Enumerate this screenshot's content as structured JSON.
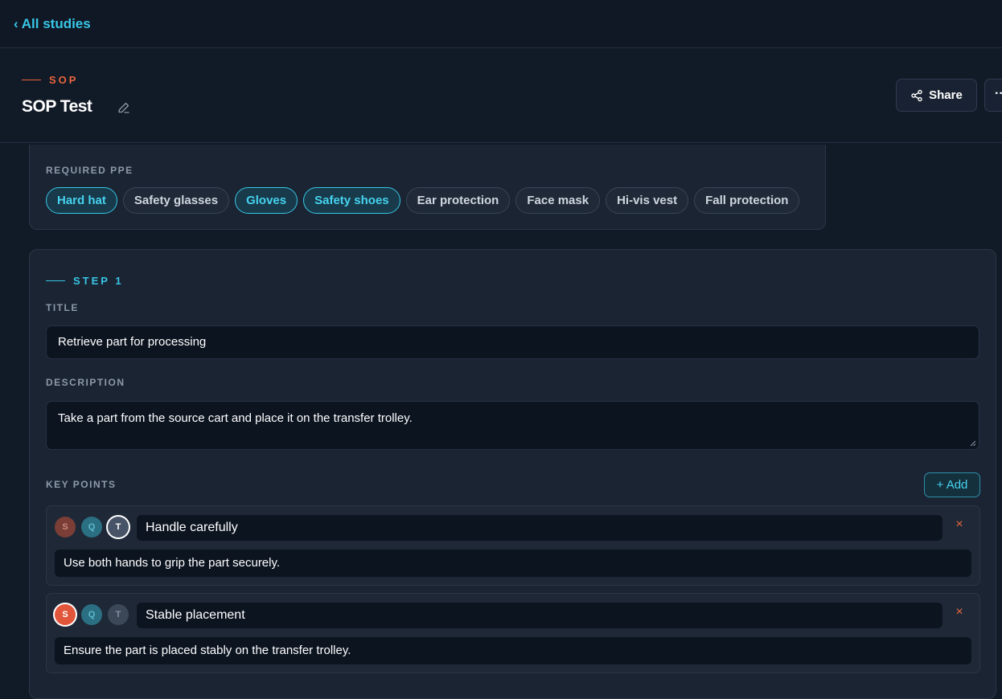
{
  "nav": {
    "back_label": "‹ All studies"
  },
  "header": {
    "eyebrow": "SOP",
    "title": "SOP Test",
    "share_label": "Share",
    "more_label": "···"
  },
  "ppe": {
    "label": "REQUIRED PPE",
    "chips": [
      {
        "label": "Hard hat",
        "selected": true
      },
      {
        "label": "Safety glasses",
        "selected": false
      },
      {
        "label": "Gloves",
        "selected": true
      },
      {
        "label": "Safety shoes",
        "selected": true
      },
      {
        "label": "Ear protection",
        "selected": false
      },
      {
        "label": "Face mask",
        "selected": false
      },
      {
        "label": "Hi-vis vest",
        "selected": false
      },
      {
        "label": "Fall protection",
        "selected": false
      }
    ]
  },
  "step": {
    "eyebrow": "STEP 1",
    "title_label": "TITLE",
    "title_value": "Retrieve part for processing",
    "description_label": "DESCRIPTION",
    "description_value": "Take a part from the source cart and place it on the transfer trolley.",
    "key_points_label": "KEY POINTS",
    "add_label": "+ Add",
    "key_points": [
      {
        "badges": {
          "s": "S",
          "q": "Q",
          "t": "T"
        },
        "active": "T",
        "title": "Handle carefully",
        "body": "Use both hands to grip the part securely.",
        "remove": "×"
      },
      {
        "badges": {
          "s": "S",
          "q": "Q",
          "t": "T"
        },
        "active": "S",
        "title": "Stable placement",
        "body": "Ensure the part is placed stably on the transfer trolley.",
        "remove": "×"
      }
    ]
  },
  "colors": {
    "accent_cyan": "#38c6e6",
    "accent_orange": "#e8653d",
    "background": "#111a27",
    "card": "#1a2433"
  }
}
